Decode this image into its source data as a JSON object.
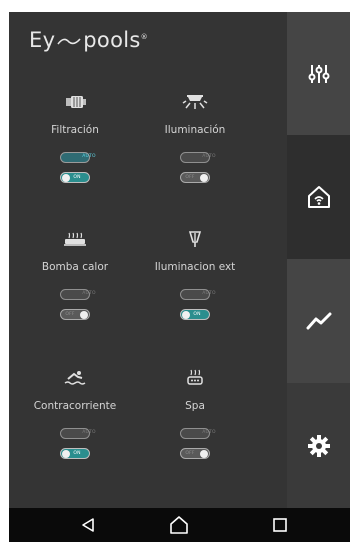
{
  "app": {
    "logo_prefix": "Ey",
    "logo_suffix": "pools",
    "logo_mark": "®"
  },
  "devices": [
    {
      "name": "Filtración",
      "icon": "pump-icon",
      "auto_label": "AUTO",
      "auto_on": true,
      "power_label": "ON",
      "power_on": true
    },
    {
      "name": "Iluminación",
      "icon": "light-icon",
      "auto_label": "AUTO",
      "auto_on": false,
      "power_label": "OFF",
      "power_on": false
    },
    {
      "name": "Bomba calor",
      "icon": "heat-pump-icon",
      "auto_label": "AUTO",
      "auto_on": false,
      "power_label": "OFF",
      "power_on": false
    },
    {
      "name": "Iluminacion ext",
      "icon": "outdoor-light-icon",
      "auto_label": "AUTO",
      "auto_on": false,
      "power_label": "ON",
      "power_on": true
    },
    {
      "name": "Contracorriente",
      "icon": "swimmer-icon",
      "auto_label": "AUTO",
      "auto_on": false,
      "power_label": "ON",
      "power_on": true
    },
    {
      "name": "Spa",
      "icon": "spa-icon",
      "auto_label": "AUTO",
      "auto_on": false,
      "power_label": "OFF",
      "power_on": false
    }
  ],
  "sidebar": [
    {
      "icon": "sliders-icon",
      "active": false
    },
    {
      "icon": "smart-home-icon",
      "active": true
    },
    {
      "icon": "chart-icon",
      "active": false
    },
    {
      "icon": "gear-icon",
      "active": false
    }
  ],
  "colors": {
    "background": "#343434",
    "accent": "#2b8e8e",
    "text": "#d4d4d4"
  }
}
